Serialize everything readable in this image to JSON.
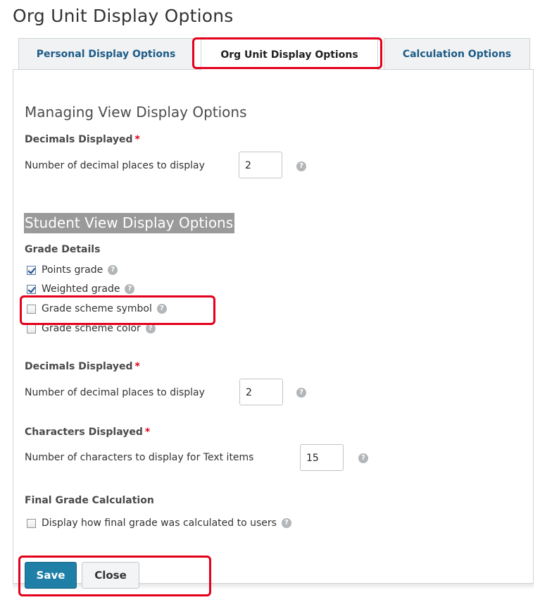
{
  "page": {
    "title": "Org Unit Display Options"
  },
  "tabs": [
    {
      "label": "Personal Display Options"
    },
    {
      "label": "Org Unit Display Options",
      "active": true
    },
    {
      "label": "Calculation Options"
    }
  ],
  "managing": {
    "heading": "Managing View Display Options",
    "decimals_label": "Decimals Displayed",
    "decimals_text": "Number of decimal places to display",
    "decimals_value": "2"
  },
  "student": {
    "heading": "Student View Display Options",
    "grade_details_label": "Grade Details",
    "checkboxes": [
      {
        "label": "Points grade",
        "checked": true
      },
      {
        "label": "Weighted grade",
        "checked": true
      },
      {
        "label": "Grade scheme symbol",
        "checked": false
      },
      {
        "label": "Grade scheme color",
        "checked": false
      }
    ],
    "decimals_label": "Decimals Displayed",
    "decimals_text": "Number of decimal places to display",
    "decimals_value": "2",
    "chars_label": "Characters Displayed",
    "chars_text": "Number of characters to display for Text items",
    "chars_value": "15",
    "final_label": "Final Grade Calculation",
    "final_checkbox": {
      "label": "Display how final grade was calculated to users",
      "checked": false
    }
  },
  "required_mark": "*",
  "help_glyph": "?",
  "buttons": {
    "save": "Save",
    "close": "Close"
  },
  "colors": {
    "accent": "#1f7fa6",
    "link": "#1c5c88",
    "required": "#e2001a",
    "annotation": "#e3001b"
  }
}
